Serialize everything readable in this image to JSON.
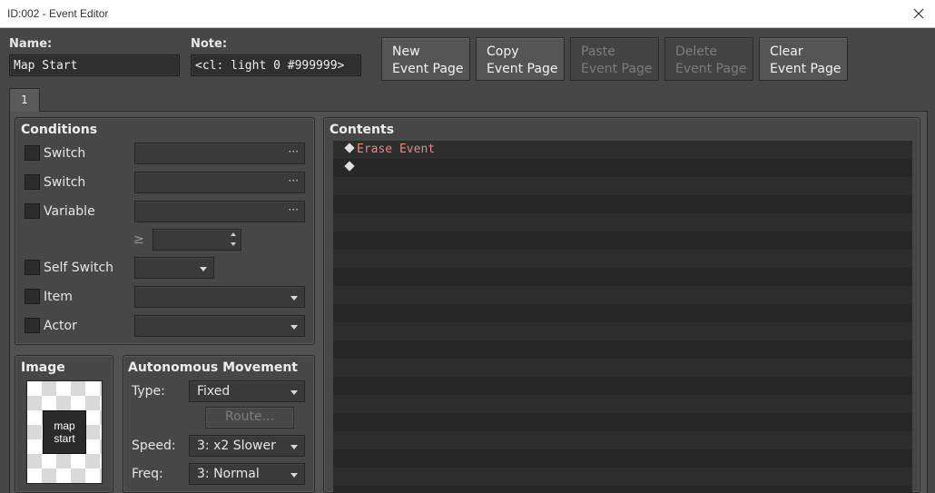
{
  "window": {
    "title": "ID:002 - Event Editor",
    "close_icon": "close-icon"
  },
  "header": {
    "name_label": "Name:",
    "name_value": "Map Start",
    "note_label": "Note:",
    "note_value": "<cl: light 0 #999999>"
  },
  "toolbar": {
    "buttons": [
      {
        "line1": "New",
        "line2": "Event Page",
        "enabled": true
      },
      {
        "line1": "Copy",
        "line2": "Event Page",
        "enabled": true
      },
      {
        "line1": "Paste",
        "line2": "Event Page",
        "enabled": false
      },
      {
        "line1": "Delete",
        "line2": "Event Page",
        "enabled": false
      },
      {
        "line1": "Clear",
        "line2": "Event Page",
        "enabled": true
      }
    ]
  },
  "tabs": [
    {
      "label": "1",
      "active": true
    }
  ],
  "conditions": {
    "title": "Conditions",
    "switch1_label": "Switch",
    "switch2_label": "Switch",
    "variable_label": "Variable",
    "gte_symbol": "≥",
    "self_switch_label": "Self Switch",
    "item_label": "Item",
    "actor_label": "Actor",
    "ellipsis": "···"
  },
  "image": {
    "title": "Image",
    "thumbnail_line1": "map",
    "thumbnail_line2": "start"
  },
  "movement": {
    "title": "Autonomous Movement",
    "type_label": "Type:",
    "type_value": "Fixed",
    "route_label": "Route...",
    "speed_label": "Speed:",
    "speed_value": "3: x2 Slower",
    "freq_label": "Freq:",
    "freq_value": "3: Normal"
  },
  "contents": {
    "title": "Contents",
    "lines": [
      "Erase Event",
      ""
    ]
  },
  "colors": {
    "background": "#474747",
    "command_erase": "#e38a80"
  }
}
